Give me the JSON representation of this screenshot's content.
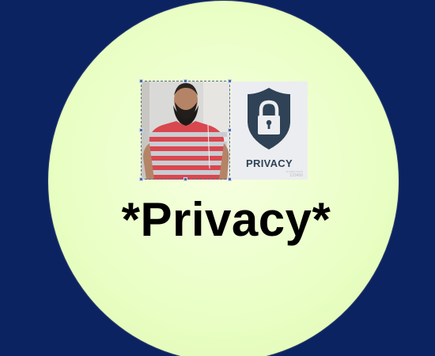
{
  "slide": {
    "heading": "*Privacy*",
    "background_color": "#0b2461",
    "circle_color": "#eaffc6"
  },
  "privacy_image": {
    "label": "PRIVACY",
    "icon": "lock-shield-icon",
    "watermark_top": "shutterstock",
    "watermark_bottom": "123456"
  },
  "photo": {
    "description_icon": "person-photo"
  }
}
